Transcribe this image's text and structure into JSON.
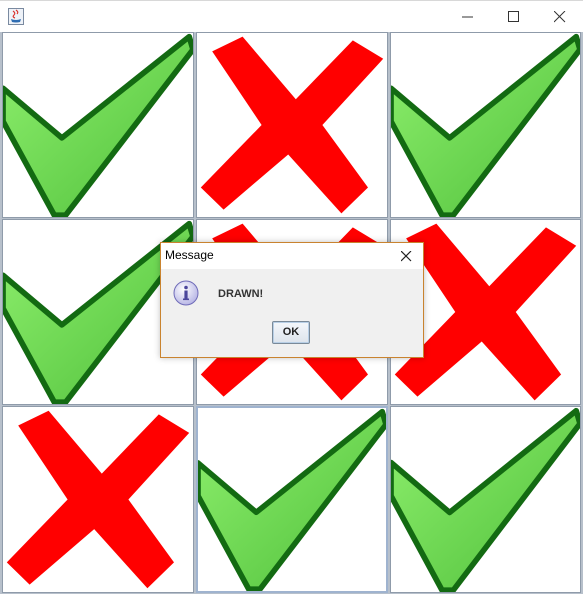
{
  "window": {
    "title": "",
    "controls": [
      "minimize-icon",
      "maximize-icon",
      "close-icon"
    ]
  },
  "board": {
    "cells": [
      {
        "row": 1,
        "col": 1,
        "mark": "check"
      },
      {
        "row": 1,
        "col": 2,
        "mark": "cross"
      },
      {
        "row": 1,
        "col": 3,
        "mark": "check"
      },
      {
        "row": 2,
        "col": 1,
        "mark": "check"
      },
      {
        "row": 2,
        "col": 2,
        "mark": "cross"
      },
      {
        "row": 2,
        "col": 3,
        "mark": "cross"
      },
      {
        "row": 3,
        "col": 1,
        "mark": "cross"
      },
      {
        "row": 3,
        "col": 2,
        "mark": "check"
      },
      {
        "row": 3,
        "col": 3,
        "mark": "check"
      }
    ],
    "colors": {
      "check": "#4fbf3a",
      "check_outline": "#136a12",
      "cross": "#ff0000"
    }
  },
  "dialog": {
    "title": "Message",
    "message": "DRAWN!",
    "ok_label": "OK",
    "icon": "info-icon",
    "border_color": "#c9832f"
  }
}
